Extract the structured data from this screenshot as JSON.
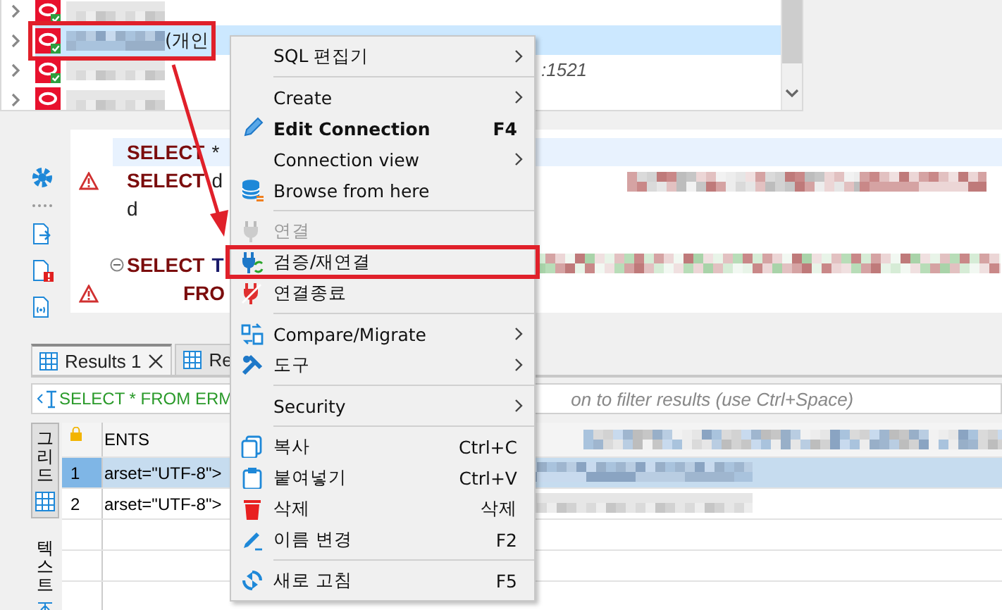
{
  "navigator": {
    "rows": [
      {
        "connected": true,
        "selected": false
      },
      {
        "connected": true,
        "selected": true,
        "highlighted": true,
        "name_suffix": "(개인"
      },
      {
        "connected": true,
        "selected": false,
        "host": ":1521"
      },
      {
        "connected": false,
        "selected": false
      }
    ]
  },
  "editor": {
    "lines": [
      {
        "kind": "code",
        "tokens": [
          {
            "kind": "keyword",
            "text": "SELECT"
          },
          {
            "kind": "plain",
            "text": "*"
          }
        ],
        "current": true
      },
      {
        "kind": "code",
        "tokens": [
          {
            "kind": "keyword",
            "text": "SELECT"
          },
          {
            "kind": "plain",
            "text": "d"
          }
        ],
        "warning": true
      },
      {
        "kind": "code",
        "tokens": [
          {
            "kind": "plain",
            "text": "d"
          }
        ]
      },
      {
        "kind": "blank"
      },
      {
        "kind": "code",
        "tokens": [
          {
            "kind": "keyword",
            "text": "SELECT"
          },
          {
            "kind": "identifier",
            "text": "T"
          }
        ],
        "fold": true
      },
      {
        "kind": "code",
        "tokens": [
          {
            "kind": "keyword",
            "text": "FRO"
          }
        ],
        "warning": true,
        "indent": true
      }
    ]
  },
  "results": {
    "tabs": [
      {
        "label": "Results 1",
        "selected": true,
        "closable": true
      },
      {
        "label": "Re",
        "selected": false
      }
    ],
    "filter": {
      "query": "SELECT * FROM ERM",
      "placeholder": "on to filter results (use Ctrl+Space)"
    },
    "view_tabs": [
      {
        "label": "그리드",
        "selected": true
      },
      {
        "label": "텍스트",
        "selected": false
      }
    ],
    "columns": [
      "ENTS"
    ],
    "rows": [
      {
        "number": "1",
        "cells": [
          "arset=\"UTF-8\">"
        ],
        "selected": true
      },
      {
        "number": "2",
        "cells": [
          "arset=\"UTF-8\">"
        ],
        "selected": false
      }
    ]
  },
  "context_menu": {
    "items": [
      {
        "kind": "item",
        "label": "SQL 편집기",
        "submenu": true
      },
      {
        "kind": "separator"
      },
      {
        "kind": "item",
        "label": "Create",
        "submenu": true
      },
      {
        "kind": "item",
        "label": "Edit Connection",
        "shortcut": "F4",
        "bold": true
      },
      {
        "kind": "item",
        "label": "Connection view",
        "submenu": true
      },
      {
        "kind": "item",
        "label": "Browse from here"
      },
      {
        "kind": "separator"
      },
      {
        "kind": "item",
        "label": "연결",
        "disabled": true
      },
      {
        "kind": "item",
        "label": "검증/재연결",
        "highlighted": true
      },
      {
        "kind": "item",
        "label": "연결종료"
      },
      {
        "kind": "separator"
      },
      {
        "kind": "item",
        "label": "Compare/Migrate",
        "submenu": true
      },
      {
        "kind": "item",
        "label": "도구",
        "submenu": true
      },
      {
        "kind": "separator"
      },
      {
        "kind": "item",
        "label": "Security",
        "submenu": true
      },
      {
        "kind": "separator"
      },
      {
        "kind": "item",
        "label": "복사",
        "shortcut": "Ctrl+C"
      },
      {
        "kind": "item",
        "label": "붙여넣기",
        "shortcut": "Ctrl+V"
      },
      {
        "kind": "item",
        "label": "삭제",
        "shortcut": "삭제"
      },
      {
        "kind": "item",
        "label": "이름 변경",
        "shortcut": "F2"
      },
      {
        "kind": "separator"
      },
      {
        "kind": "item",
        "label": "새로 고침",
        "shortcut": "F5"
      }
    ]
  }
}
